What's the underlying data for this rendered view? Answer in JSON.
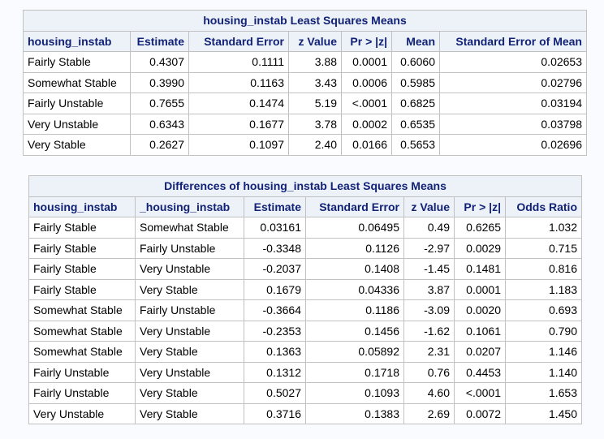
{
  "lsmeans": {
    "title": "housing_instab Least Squares Means",
    "headers": [
      "housing_instab",
      "Estimate",
      "Standard Error",
      "z Value",
      "Pr > |z|",
      "Mean",
      "Standard Error of Mean"
    ],
    "rows": [
      [
        "Fairly Stable",
        "0.4307",
        "0.1111",
        "3.88",
        "0.0001",
        "0.6060",
        "0.02653"
      ],
      [
        "Somewhat Stable",
        "0.3990",
        "0.1163",
        "3.43",
        "0.0006",
        "0.5985",
        "0.02796"
      ],
      [
        "Fairly Unstable",
        "0.7655",
        "0.1474",
        "5.19",
        "<.0001",
        "0.6825",
        "0.03194"
      ],
      [
        "Very Unstable",
        "0.6343",
        "0.1677",
        "3.78",
        "0.0002",
        "0.6535",
        "0.03798"
      ],
      [
        "Very Stable",
        "0.2627",
        "0.1097",
        "2.40",
        "0.0166",
        "0.5653",
        "0.02696"
      ]
    ]
  },
  "differences": {
    "title": "Differences of housing_instab Least Squares Means",
    "headers": [
      "housing_instab",
      "_housing_instab",
      "Estimate",
      "Standard Error",
      "z Value",
      "Pr > |z|",
      "Odds Ratio"
    ],
    "rows": [
      [
        "Fairly Stable",
        "Somewhat Stable",
        "0.03161",
        "0.06495",
        "0.49",
        "0.6265",
        "1.032"
      ],
      [
        "Fairly Stable",
        "Fairly Unstable",
        "-0.3348",
        "0.1126",
        "-2.97",
        "0.0029",
        "0.715"
      ],
      [
        "Fairly Stable",
        "Very Unstable",
        "-0.2037",
        "0.1408",
        "-1.45",
        "0.1481",
        "0.816"
      ],
      [
        "Fairly Stable",
        "Very Stable",
        "0.1679",
        "0.04336",
        "3.87",
        "0.0001",
        "1.183"
      ],
      [
        "Somewhat Stable",
        "Fairly Unstable",
        "-0.3664",
        "0.1186",
        "-3.09",
        "0.0020",
        "0.693"
      ],
      [
        "Somewhat Stable",
        "Very Unstable",
        "-0.2353",
        "0.1456",
        "-1.62",
        "0.1061",
        "0.790"
      ],
      [
        "Somewhat Stable",
        "Very Stable",
        "0.1363",
        "0.05892",
        "2.31",
        "0.0207",
        "1.146"
      ],
      [
        "Fairly Unstable",
        "Very Unstable",
        "0.1312",
        "0.1718",
        "0.76",
        "0.4453",
        "1.140"
      ],
      [
        "Fairly Unstable",
        "Very Stable",
        "0.5027",
        "0.1093",
        "4.60",
        "<.0001",
        "1.653"
      ],
      [
        "Very Unstable",
        "Very Stable",
        "0.3716",
        "0.1383",
        "2.69",
        "0.0072",
        "1.450"
      ]
    ]
  },
  "colors": {
    "header_bg": "#edf2f9",
    "header_text": "#112277",
    "border": "#c1c1c1",
    "page_bg": "#fafbfe"
  }
}
